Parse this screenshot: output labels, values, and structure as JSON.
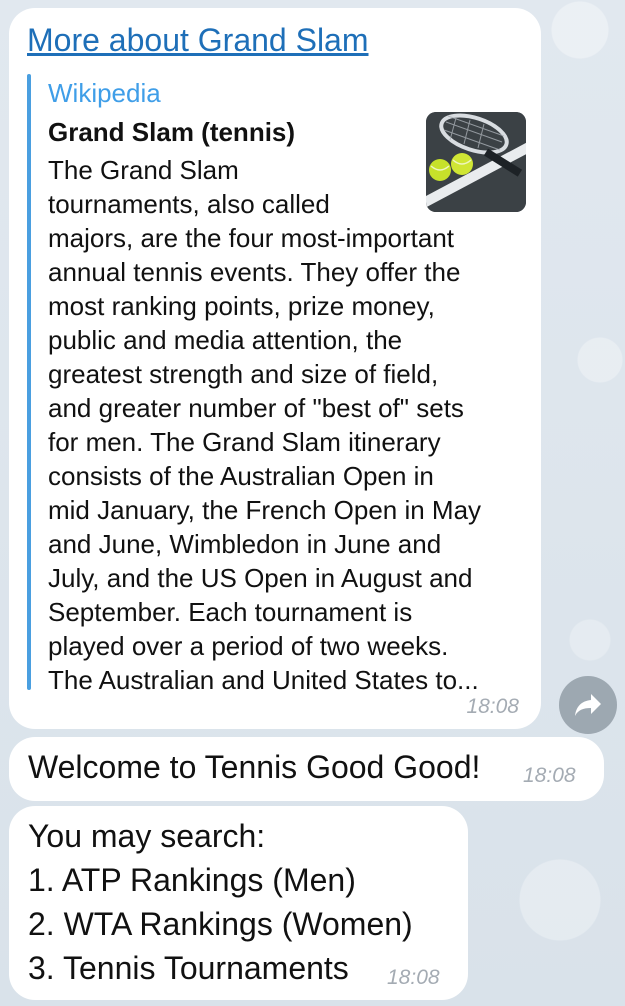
{
  "link_message": {
    "link_text": "More about Grand Slam",
    "preview": {
      "site_name": "Wikipedia",
      "title": "Grand Slam (tennis)",
      "thumbnail_icon": "tennis-racket-balls-image",
      "description_lines": [
        "The Grand Slam",
        "tournaments, also called",
        "majors, are the four most-important",
        "annual tennis events. They offer the",
        "most ranking points, prize money,",
        "public and media attention, the",
        "greatest strength and size of field,",
        "and greater number of \"best of\" sets",
        "for men. The Grand Slam itinerary",
        "consists of the Australian Open in",
        "mid January, the French Open in May",
        "and June, Wimbledon in June and",
        "July, and the US Open in August and",
        "September. Each tournament is",
        "played over a period of two weeks.",
        "The Australian and United States to..."
      ]
    },
    "time": "18:08"
  },
  "forward_button": {
    "icon": "forward-arrow-icon"
  },
  "welcome_message": {
    "text": "Welcome to Tennis Good Good!",
    "time": "18:08"
  },
  "search_message": {
    "lines": [
      "You may search:",
      "1. ATP Rankings (Men)",
      "2. WTA Rankings (Women)",
      "3. Tennis Tournaments"
    ],
    "time": "18:08"
  },
  "colors": {
    "bubble": "#ffffff",
    "link": "#1e6fb8",
    "accent_bar": "#4a9fe0",
    "site_name": "#3f9ee8",
    "timestamp": "#a4abb3",
    "wallpaper": "#dde6ee"
  }
}
